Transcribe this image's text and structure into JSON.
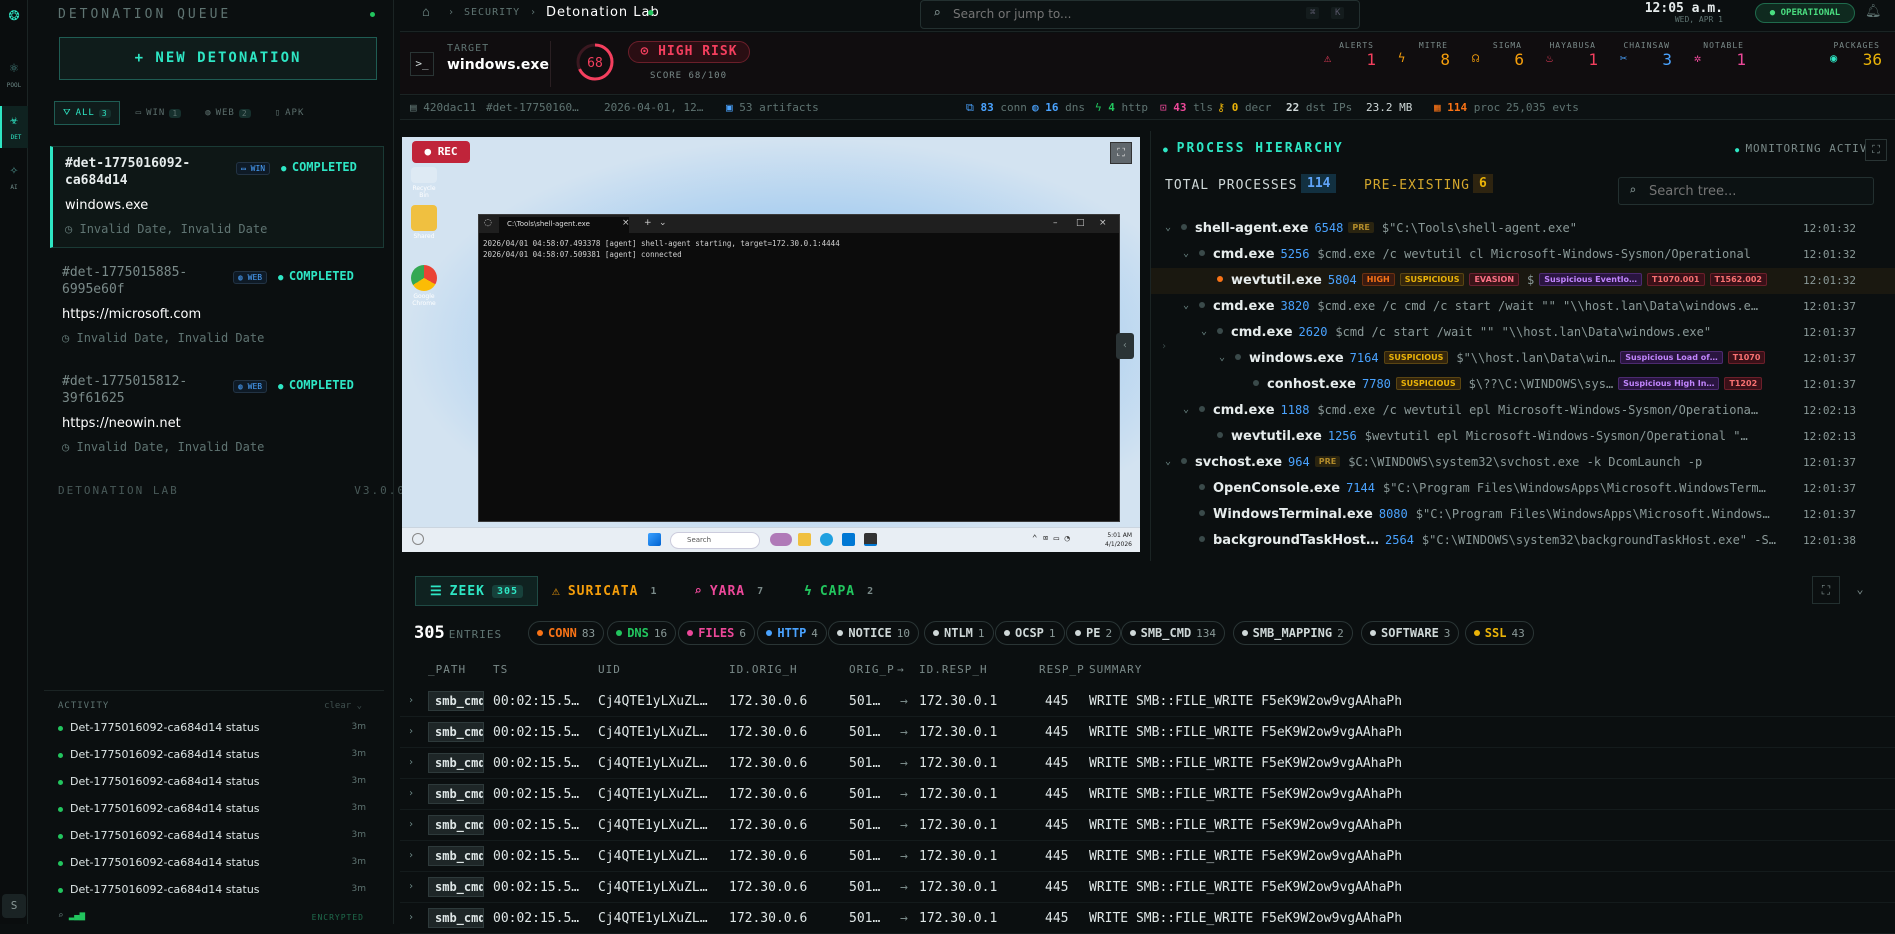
{
  "rail": {
    "items": [
      {
        "label": "POOL",
        "icon": "pool-icon"
      },
      {
        "label": "DET",
        "icon": "biohazard-icon"
      },
      {
        "label": "AI",
        "icon": "sparkle-icon"
      }
    ],
    "user_initial": "S"
  },
  "queue": {
    "title": "DETONATION QUEUE",
    "new_button": "+ NEW DETONATION",
    "filters": [
      {
        "label": "ALL",
        "count": "3"
      },
      {
        "label": "WIN",
        "count": "1"
      },
      {
        "label": "WEB",
        "count": "2"
      },
      {
        "label": "APK",
        "count": ""
      }
    ],
    "items": [
      {
        "id": "#det-1775016092-ca684d14",
        "badge": "WIN",
        "status": "COMPLETED",
        "name": "windows.exe",
        "date": "Invalid Date, Invalid Date"
      },
      {
        "id": "#det-1775015885-6995e60f",
        "badge": "WEB",
        "status": "COMPLETED",
        "name": "https://microsoft.com",
        "date": "Invalid Date, Invalid Date"
      },
      {
        "id": "#det-1775015812-39f61625",
        "badge": "WEB",
        "status": "COMPLETED",
        "name": "https://neowin.net",
        "date": "Invalid Date, Invalid Date"
      }
    ],
    "footer_left": "DETONATION LAB",
    "footer_right": "V3.0.0"
  },
  "activity": {
    "title": "ACTIVITY",
    "clear": "clear",
    "rows": [
      {
        "text": "Det-1775016092-ca684d14 status",
        "time": "3m"
      },
      {
        "text": "Det-1775016092-ca684d14 status",
        "time": "3m"
      },
      {
        "text": "Det-1775016092-ca684d14 status",
        "time": "3m"
      },
      {
        "text": "Det-1775016092-ca684d14 status",
        "time": "3m"
      },
      {
        "text": "Det-1775016092-ca684d14 status",
        "time": "3m"
      },
      {
        "text": "Det-1775016092-ca684d14 status",
        "time": "3m"
      },
      {
        "text": "Det-1775016092-ca684d14 status",
        "time": "3m"
      }
    ],
    "footer": "ENCRYPTED"
  },
  "topbar": {
    "breadcrumb_section": "SECURITY",
    "breadcrumb_page": "Detonation Lab",
    "search_placeholder": "Search or jump to...",
    "kbd1": "⌘",
    "kbd2": "K",
    "time": "12:05 a.m.",
    "date": "WED, APR 1",
    "status": "OPERATIONAL"
  },
  "target": {
    "label": "TARGET",
    "value": "windows.exe",
    "score": "68",
    "risk": "HIGH RISK",
    "score_text": "SCORE 68/100",
    "stats": [
      {
        "label": "ALERTS",
        "value": "1",
        "color": "#f43f5e",
        "icon": "warning-icon"
      },
      {
        "label": "MITRE",
        "value": "8",
        "color": "#f59e0b",
        "icon": "bolt-icon"
      },
      {
        "label": "SIGMA",
        "value": "6",
        "color": "#f59e0b",
        "icon": "sigma-icon"
      },
      {
        "label": "HAYABUSA",
        "value": "1",
        "color": "#f43f5e",
        "icon": "flame-icon"
      },
      {
        "label": "CHAINSAW",
        "value": "3",
        "color": "#4aa3ff",
        "icon": "chainsaw-icon"
      },
      {
        "label": "NOTABLE",
        "value": "1",
        "color": "#ec4899",
        "icon": "gear-icon"
      },
      {
        "label": "PACKAGES",
        "value": "36",
        "color": "#eab308",
        "icon": "package-icon"
      }
    ]
  },
  "meta": {
    "hash": "420dac11",
    "det": "#det-17750160…",
    "date": "2026-04-01, 12…",
    "artifacts": "53 artifacts",
    "conn": "83",
    "conn_label": "conn",
    "dns": "16",
    "dns_label": "dns",
    "http": "4",
    "http_label": "http",
    "tls": "43",
    "tls_label": "tls",
    "decr": "0",
    "decr_label": "decr",
    "dst_ips": "22",
    "dst_label": "dst IPs",
    "size": "23.2 MB",
    "proc": "114",
    "proc_label": "proc",
    "evts": "25,035 evts"
  },
  "video": {
    "rec": "REC",
    "desktop_icons": [
      "Recycle Bin",
      "Shared",
      "Google Chrome"
    ],
    "terminal_title": "C:\\Tools\\shell-agent.exe",
    "terminal_lines": [
      "2026/04/01 04:58:07.493378 [agent] shell-agent starting, target=172.30.0.1:4444",
      "2026/04/01 04:58:07.509381 [agent] connected"
    ],
    "taskbar_search": "Search",
    "taskbar_time": "5:01 AM",
    "taskbar_date": "4/1/2026"
  },
  "process": {
    "title": "PROCESS HIERARCHY",
    "monitoring": "MONITORING ACTIVE",
    "total_label": "TOTAL PROCESSES",
    "total": "114",
    "pre_label": "PRE-EXISTING",
    "pre": "6",
    "search_placeholder": "Search tree...",
    "rows": [
      {
        "name": "shell-agent.exe",
        "pid": "6548",
        "tags": [
          "PRE"
        ],
        "cmd": "$\"C:\\Tools\\shell-agent.exe\"",
        "time": "12:01:32",
        "level": 0,
        "chev": true
      },
      {
        "name": "cmd.exe",
        "pid": "5256",
        "tags": [],
        "cmd": "$cmd.exe /c wevtutil cl Microsoft-Windows-Sysmon/Operational",
        "time": "12:01:32",
        "level": 1,
        "chev": true
      },
      {
        "name": "wevtutil.exe",
        "pid": "5804",
        "tags": [
          "HIGH",
          "SUSPICIOUS",
          "EVASION",
          "$",
          "Suspicious Eventlo…",
          "T1070.001",
          "T1562.002"
        ],
        "cmd": "",
        "time": "12:01:32",
        "level": 2,
        "chev": false,
        "hl": true
      },
      {
        "name": "cmd.exe",
        "pid": "3820",
        "tags": [],
        "cmd": "$cmd.exe /c cmd /c start /wait \"\" \"\\\\host.lan\\Data\\windows.e…",
        "time": "12:01:37",
        "level": 1,
        "chev": true
      },
      {
        "name": "cmd.exe",
        "pid": "2620",
        "tags": [],
        "cmd": "$cmd /c start /wait \"\" \"\\\\host.lan\\Data\\windows.exe\"",
        "time": "12:01:37",
        "level": 2,
        "chev": true
      },
      {
        "name": "windows.exe",
        "pid": "7164",
        "tags": [
          "SUSPICIOUS",
          "$\"\\\\host.lan\\Data\\win…",
          "Suspicious Load of…",
          "T1070"
        ],
        "cmd": "",
        "time": "12:01:37",
        "level": 3,
        "chev": true
      },
      {
        "name": "conhost.exe",
        "pid": "7780",
        "tags": [
          "SUSPICIOUS",
          "$\\??\\C:\\WINDOWS\\sys…",
          "Suspicious High In…",
          "T1202"
        ],
        "cmd": "",
        "time": "12:01:37",
        "level": 4,
        "chev": false
      },
      {
        "name": "cmd.exe",
        "pid": "1188",
        "tags": [],
        "cmd": "$cmd.exe /c wevtutil epl Microsoft-Windows-Sysmon/Operationa…",
        "time": "12:02:13",
        "level": 1,
        "chev": true
      },
      {
        "name": "wevtutil.exe",
        "pid": "1256",
        "tags": [],
        "cmd": "$wevtutil epl Microsoft-Windows-Sysmon/Operational \"…",
        "time": "12:02:13",
        "level": 2,
        "chev": false
      },
      {
        "name": "svchost.exe",
        "pid": "964",
        "tags": [
          "PRE"
        ],
        "cmd": "$C:\\WINDOWS\\system32\\svchost.exe -k DcomLaunch -p",
        "time": "12:01:37",
        "level": 0,
        "chev": true
      },
      {
        "name": "OpenConsole.exe",
        "pid": "7144",
        "tags": [],
        "cmd": "$\"C:\\Program Files\\WindowsApps\\Microsoft.WindowsTerm…",
        "time": "12:01:37",
        "level": 1,
        "chev": false
      },
      {
        "name": "WindowsTerminal.exe",
        "pid": "8080",
        "tags": [],
        "cmd": "$\"C:\\Program Files\\WindowsApps\\Microsoft.Windows…",
        "time": "12:01:37",
        "level": 1,
        "chev": false
      },
      {
        "name": "backgroundTaskHost…",
        "pid": "2564",
        "tags": [],
        "cmd": "$\"C:\\WINDOWS\\system32\\backgroundTaskHost.exe\" -S…",
        "time": "12:01:38",
        "level": 1,
        "chev": false
      }
    ]
  },
  "logs": {
    "tabs": [
      {
        "label": "ZEEK",
        "count": "305",
        "icon": "database-icon",
        "color": "#2ee6c4"
      },
      {
        "label": "SURICATA",
        "count": "1",
        "icon": "warning-icon",
        "color": "#f59e0b"
      },
      {
        "label": "YARA",
        "count": "7",
        "icon": "search-icon",
        "color": "#ec4899"
      },
      {
        "label": "CAPA",
        "count": "2",
        "icon": "bolt-icon",
        "color": "#22c55e"
      }
    ],
    "entries_count": "305",
    "entries_label": "ENTRIES",
    "chips": [
      {
        "label": "CONN",
        "count": "83",
        "color": "#f97316"
      },
      {
        "label": "DNS",
        "count": "16",
        "color": "#22c55e"
      },
      {
        "label": "FILES",
        "count": "6",
        "color": "#ec4899"
      },
      {
        "label": "HTTP",
        "count": "4",
        "color": "#4aa3ff"
      },
      {
        "label": "NOTICE",
        "count": "10",
        "color": "#cfd8d8"
      },
      {
        "label": "NTLM",
        "count": "1",
        "color": "#cfd8d8"
      },
      {
        "label": "OCSP",
        "count": "1",
        "color": "#cfd8d8"
      },
      {
        "label": "PE",
        "count": "2",
        "color": "#cfd8d8"
      },
      {
        "label": "SMB_CMD",
        "count": "134",
        "color": "#cfd8d8"
      },
      {
        "label": "SMB_MAPPING",
        "count": "2",
        "color": "#cfd8d8"
      },
      {
        "label": "SOFTWARE",
        "count": "3",
        "color": "#cfd8d8"
      },
      {
        "label": "SSL",
        "count": "43",
        "color": "#eab308"
      }
    ],
    "columns": [
      "_PATH",
      "TS",
      "UID",
      "ID.ORIG_H",
      "ORIG_P",
      "→",
      "ID.RESP_H",
      "RESP_P",
      "SUMMARY"
    ],
    "rows": [
      {
        "path": "smb_cmd",
        "ts": "00:02:15.5…",
        "uid": "Cj4QTE1yLXuZL…",
        "orig_h": "172.30.0.6",
        "orig_p": "501…",
        "resp_h": "172.30.0.1",
        "resp_p": "445",
        "summary": "WRITE SMB::FILE_WRITE F5eK9W2ow9vgAAhaPh"
      },
      {
        "path": "smb_cmd",
        "ts": "00:02:15.5…",
        "uid": "Cj4QTE1yLXuZL…",
        "orig_h": "172.30.0.6",
        "orig_p": "501…",
        "resp_h": "172.30.0.1",
        "resp_p": "445",
        "summary": "WRITE SMB::FILE_WRITE F5eK9W2ow9vgAAhaPh"
      },
      {
        "path": "smb_cmd",
        "ts": "00:02:15.5…",
        "uid": "Cj4QTE1yLXuZL…",
        "orig_h": "172.30.0.6",
        "orig_p": "501…",
        "resp_h": "172.30.0.1",
        "resp_p": "445",
        "summary": "WRITE SMB::FILE_WRITE F5eK9W2ow9vgAAhaPh"
      },
      {
        "path": "smb_cmd",
        "ts": "00:02:15.5…",
        "uid": "Cj4QTE1yLXuZL…",
        "orig_h": "172.30.0.6",
        "orig_p": "501…",
        "resp_h": "172.30.0.1",
        "resp_p": "445",
        "summary": "WRITE SMB::FILE_WRITE F5eK9W2ow9vgAAhaPh"
      },
      {
        "path": "smb_cmd",
        "ts": "00:02:15.5…",
        "uid": "Cj4QTE1yLXuZL…",
        "orig_h": "172.30.0.6",
        "orig_p": "501…",
        "resp_h": "172.30.0.1",
        "resp_p": "445",
        "summary": "WRITE SMB::FILE_WRITE F5eK9W2ow9vgAAhaPh"
      },
      {
        "path": "smb_cmd",
        "ts": "00:02:15.5…",
        "uid": "Cj4QTE1yLXuZL…",
        "orig_h": "172.30.0.6",
        "orig_p": "501…",
        "resp_h": "172.30.0.1",
        "resp_p": "445",
        "summary": "WRITE SMB::FILE_WRITE F5eK9W2ow9vgAAhaPh"
      },
      {
        "path": "smb_cmd",
        "ts": "00:02:15.5…",
        "uid": "Cj4QTE1yLXuZL…",
        "orig_h": "172.30.0.6",
        "orig_p": "501…",
        "resp_h": "172.30.0.1",
        "resp_p": "445",
        "summary": "WRITE SMB::FILE_WRITE F5eK9W2ow9vgAAhaPh"
      },
      {
        "path": "smb_cmd",
        "ts": "00:02:15.5…",
        "uid": "Cj4QTE1yLXuZL…",
        "orig_h": "172.30.0.6",
        "orig_p": "501…",
        "resp_h": "172.30.0.1",
        "resp_p": "445",
        "summary": "WRITE SMB::FILE_WRITE F5eK9W2ow9vgAAhaPh"
      }
    ]
  }
}
